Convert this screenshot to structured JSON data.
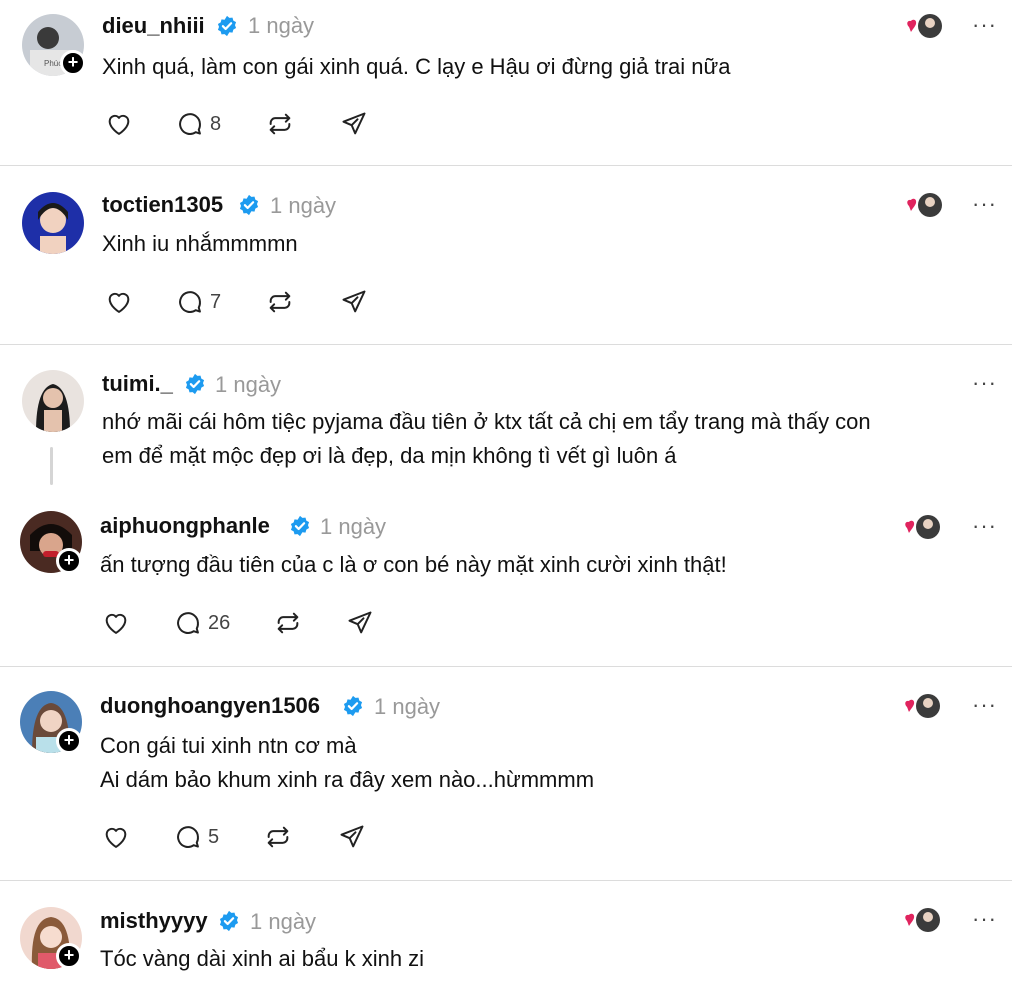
{
  "comments": [
    {
      "username": "dieu_nhiii",
      "time": "1 ngày",
      "lines": [
        "Xinh quá, làm con gái xinh quá. C lạy e Hậu ơi đừng giả trai nữa"
      ],
      "replies": "8"
    },
    {
      "username": "toctien1305",
      "time": "1 ngày",
      "lines": [
        "Xinh iu nhắmmmmn"
      ],
      "replies": "7"
    },
    {
      "username": "tuimi._",
      "time": "1 ngày",
      "lines": [
        "nhớ mãi cái hôm tiệc pyjama đầu tiên ở ktx tất cả chị em tẩy trang mà thấy con",
        "em để mặt mộc đẹp ơi là đẹp, da mịn không tì vết gì luôn á"
      ]
    },
    {
      "username": "aiphuongphanle",
      "time": "1 ngày",
      "lines": [
        "ấn tượng đầu tiên của c là ơ con bé này mặt xinh cười xinh thật!"
      ],
      "replies": "26"
    },
    {
      "username": "duonghoangyen1506",
      "time": "1 ngày",
      "lines": [
        "Con gái tui xinh ntn cơ mà",
        "Ai dám bảo khum xinh ra đây xem nào...hừmmmm"
      ],
      "replies": "5"
    },
    {
      "username": "misthyyyy",
      "time": "1 ngày",
      "lines": [
        "Tóc vàng dài xinh ai bẩu k xinh zi"
      ]
    }
  ],
  "more_label": "···",
  "follow_label": "+",
  "colors": {
    "verified": "#1d9bf0",
    "heart": "#e0245e",
    "divider": "#dcdcdc"
  },
  "icons": [
    "heart-icon",
    "comment-icon",
    "repost-icon",
    "share-icon",
    "verified-icon",
    "liked-by-creator-icon",
    "more-icon",
    "follow-plus-icon"
  ]
}
